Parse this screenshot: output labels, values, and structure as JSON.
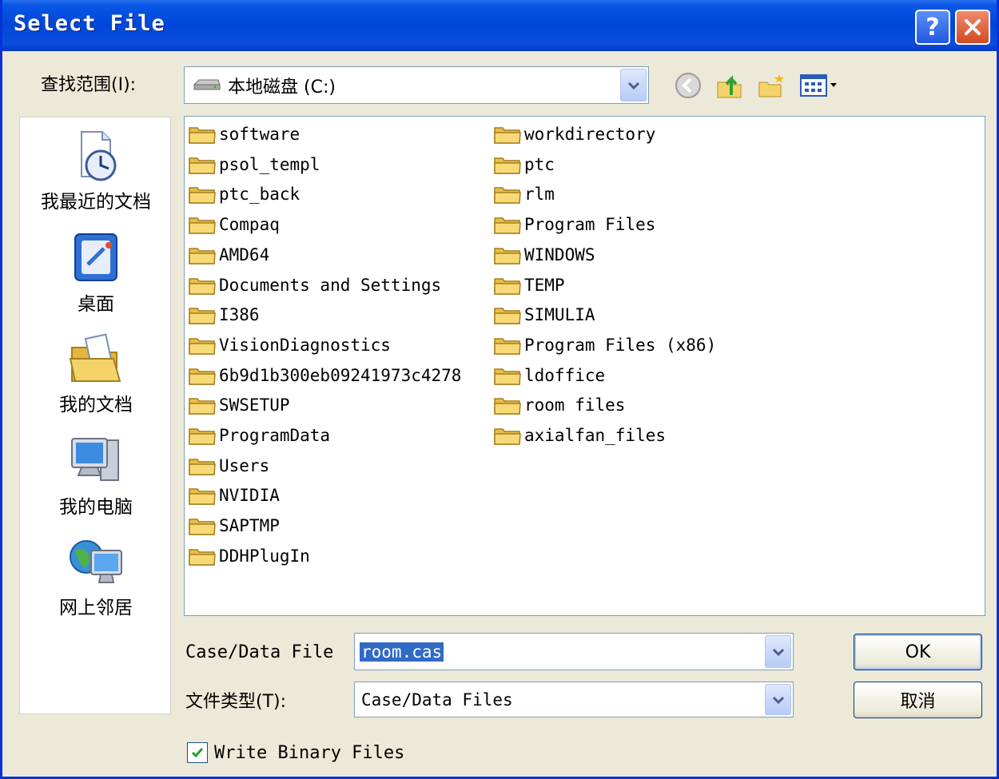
{
  "window": {
    "title": "Select File"
  },
  "lookin": {
    "label": "查找范围(I):",
    "value": "本地磁盘 (C:)"
  },
  "places": [
    {
      "label": "我最近的文档",
      "icon": "recent-documents-icon"
    },
    {
      "label": "桌面",
      "icon": "desktop-icon"
    },
    {
      "label": "我的文档",
      "icon": "my-documents-icon"
    },
    {
      "label": "我的电脑",
      "icon": "my-computer-icon"
    },
    {
      "label": "网上邻居",
      "icon": "network-places-icon"
    }
  ],
  "files": [
    "software",
    "psol_templ",
    "ptc_back",
    "Compaq",
    "AMD64",
    "Documents and Settings",
    "I386",
    "VisionDiagnostics",
    "6b9d1b300eb09241973c4278",
    "SWSETUP",
    "ProgramData",
    "Users",
    "NVIDIA",
    "SAPTMP",
    "DDHPlugIn",
    "workdirectory",
    "ptc",
    "rlm",
    "Program Files",
    "WINDOWS",
    "TEMP",
    "SIMULIA",
    "Program Files (x86)",
    "ldoffice",
    "room files",
    "axialfan_files"
  ],
  "filename": {
    "label": "Case/Data File",
    "value": "room.cas"
  },
  "filetype": {
    "label": "文件类型(T):",
    "value": "Case/Data Files"
  },
  "buttons": {
    "ok": "OK",
    "cancel": "取消"
  },
  "binary": {
    "label": "Write Binary Files",
    "checked": true
  },
  "colors": {
    "titlebar": "#0046d8",
    "selection": "#316ac5",
    "folder": "#f4d36b"
  }
}
